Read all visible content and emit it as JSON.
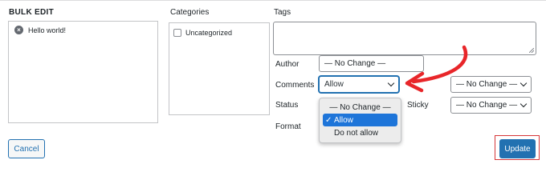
{
  "bulk_edit": {
    "title": "BULK EDIT",
    "posts": [
      {
        "title": "Hello world!"
      }
    ]
  },
  "categories": {
    "title": "Categories",
    "items": [
      {
        "label": "Uncategorized",
        "checked": false
      }
    ]
  },
  "tags": {
    "title": "Tags",
    "value": ""
  },
  "fields": {
    "author": {
      "label": "Author",
      "value": "— No Change —"
    },
    "comments": {
      "label": "Comments",
      "value": "Allow"
    },
    "pings": {
      "value": "— No Change —"
    },
    "status": {
      "label": "Status"
    },
    "sticky": {
      "label": "Sticky",
      "value": "— No Change —"
    },
    "format": {
      "label": "Format"
    }
  },
  "dropdown": {
    "options": [
      "— No Change —",
      "Allow",
      "Do not allow"
    ],
    "selected": "Allow",
    "checkmark": "✓"
  },
  "buttons": {
    "cancel": "Cancel",
    "update": "Update"
  },
  "colors": {
    "primary": "#2271b1",
    "annotation_red": "#d63638",
    "selection": "#1e75d9"
  }
}
